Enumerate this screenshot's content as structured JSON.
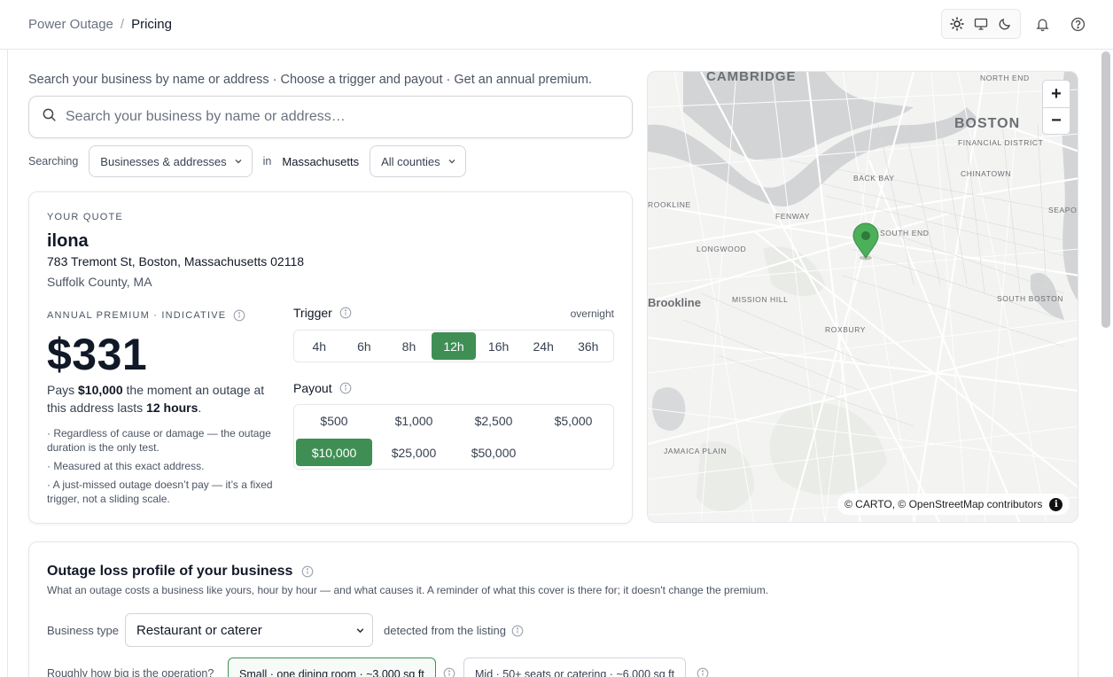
{
  "breadcrumb": {
    "parent": "Power Outage",
    "separator": "/",
    "current": "Pricing"
  },
  "intro": "Search your business by name or address · Choose a trigger and payout · Get an annual premium.",
  "search": {
    "placeholder": "Search your business by name or address…",
    "value": ""
  },
  "filters": {
    "searching_label": "Searching",
    "scope": "Businesses & addresses",
    "in_label": "in",
    "state": "Massachusetts",
    "county": "All counties"
  },
  "quote": {
    "label": "YOUR QUOTE",
    "name": "ilona",
    "address": "783 Tremont St, Boston, Massachusetts 02118",
    "county": "Suffolk County, MA",
    "premium_label": "ANNUAL PREMIUM · INDICATIVE",
    "premium": "$331",
    "desc_prefix": "Pays",
    "desc_amount": "$10,000",
    "desc_middle": "the moment an outage at this address lasts",
    "desc_hours": "12 hours",
    "desc_end": ".",
    "notes": [
      "· Regardless of cause or damage — the outage duration is the only test.",
      "· Measured at this exact address.",
      "· A just-missed outage doesn’t pay — it’s a fixed trigger, not a sliding scale."
    ],
    "trigger_label": "Trigger",
    "trigger_note": "overnight",
    "triggers": [
      "4h",
      "6h",
      "8h",
      "12h",
      "16h",
      "24h",
      "36h"
    ],
    "trigger_selected": "12h",
    "payout_label": "Payout",
    "payouts": [
      "$500",
      "$1,000",
      "$2,500",
      "$5,000",
      "$10,000",
      "$25,000",
      "$50,000"
    ],
    "payout_selected": "$10,000"
  },
  "map": {
    "labels": {
      "cambridge": "CAMBRIDGE",
      "north_end": "NORTH END",
      "boston": "BOSTON",
      "financial": "FINANCIAL DISTRICT",
      "chinatown": "CHINATOWN",
      "back_bay": "BACK BAY",
      "brookline_n": "ROOKLINE",
      "fenway": "FENWAY",
      "seaport": "SEAPOR",
      "south_end": "SOUTH END",
      "longwood": "LONGWOOD",
      "brookline": "Brookline",
      "mission_hill": "MISSION HILL",
      "south_boston": "SOUTH BOSTON",
      "roxbury": "ROXBURY",
      "jamaica_plain": "JAMAICA PLAIN"
    },
    "zoom_in": "+",
    "zoom_out": "−",
    "attribution": "© CARTO, © OpenStreetMap contributors",
    "info": "i",
    "colors": {
      "marker": "#4caf5a",
      "water": "#d4d5d6",
      "park": "#e9ebe6"
    }
  },
  "loss_profile": {
    "title": "Outage loss profile of your business",
    "description": "What an outage costs a business like yours, hour by hour — and what causes it. A reminder of what this cover is there for; it doesn't change the premium.",
    "business_type_label": "Business type",
    "business_type": "Restaurant or caterer",
    "detected_note": "detected from the listing",
    "size_label": "Roughly how big is the operation?",
    "sizes": [
      "Small · one dining room · ~3,000 sq ft",
      "Mid · 50+ seats or catering · ~6,000 sq ft"
    ],
    "size_selected": "Small · one dining room · ~3,000 sq ft"
  },
  "colors": {
    "accent": "#3f8f55",
    "border": "#e5e7eb",
    "text": "#111827",
    "muted": "#4b5563"
  }
}
